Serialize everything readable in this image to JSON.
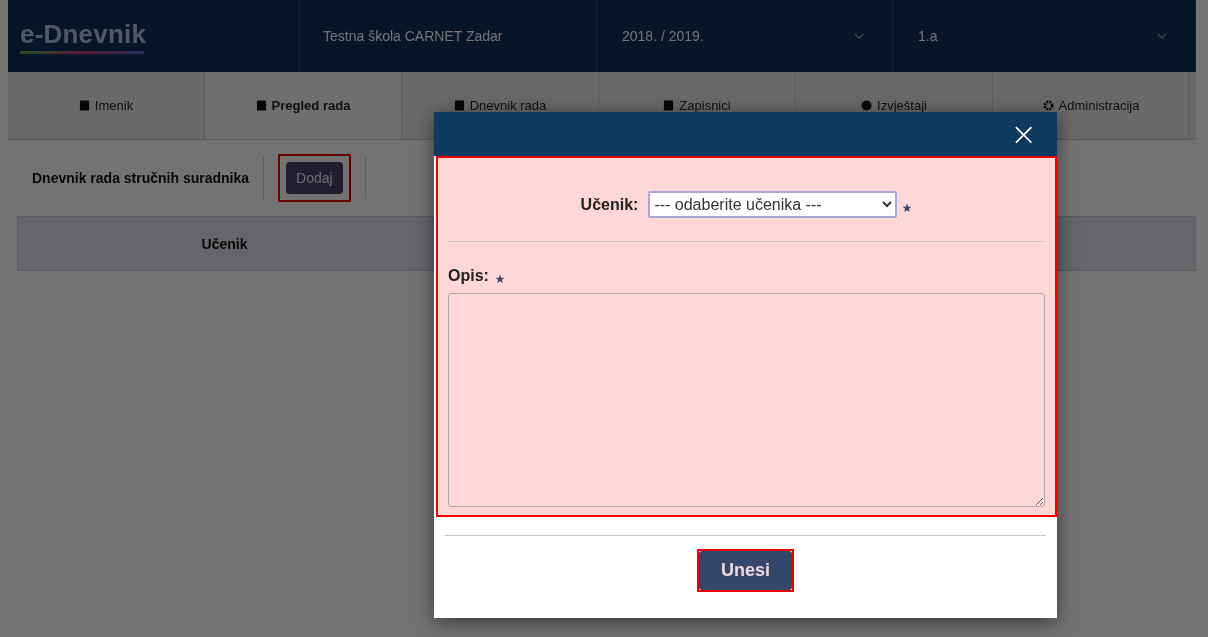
{
  "header": {
    "logo": "e-Dnevnik",
    "school": "Testna škola CARNET Zadar",
    "year": "2018. / 2019.",
    "class": "1.a"
  },
  "tabs": [
    {
      "label": "Imenik",
      "selected": false
    },
    {
      "label": "Pregled rada",
      "selected": true
    },
    {
      "label": "Dnevnik rada",
      "selected": false
    },
    {
      "label": "Zapisnici",
      "selected": false
    },
    {
      "label": "Izvještaji",
      "selected": false
    },
    {
      "label": "Administracija",
      "selected": false
    }
  ],
  "toolbar": {
    "title": "Dnevnik rada stručnih suradnika",
    "add_button": "Dodaj"
  },
  "table": {
    "columns": [
      "Učenik"
    ]
  },
  "modal": {
    "close": "×",
    "student": {
      "label": "Učenik:",
      "value": "--- odaberite učenika ---",
      "required": true
    },
    "description": {
      "label": "Opis:",
      "required": true
    },
    "submit": "Unesi"
  }
}
